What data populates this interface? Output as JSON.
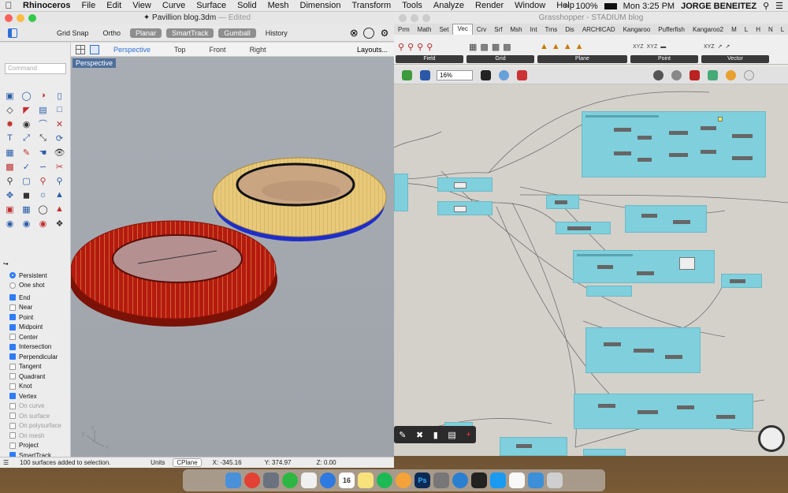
{
  "menubar": {
    "app": "Rhinoceros",
    "items": [
      "File",
      "Edit",
      "View",
      "Curve",
      "Surface",
      "Solid",
      "Mesh",
      "Dimension",
      "Transform",
      "Tools",
      "Analyze",
      "Render",
      "Window",
      "Help"
    ],
    "battery": "100%",
    "clock": "Mon 3:25 PM",
    "user": "JORGE BENEITEZ"
  },
  "rhino": {
    "file_name": "Pavillion blog.3dm",
    "file_state": "— Edited",
    "toolbar": {
      "grid_snap": "Grid Snap",
      "ortho": "Ortho",
      "planar": "Planar",
      "smarttrack": "SmartTrack",
      "gumball": "Gumball",
      "history": "History"
    },
    "viewport_tabs": [
      "Perspective",
      "Top",
      "Front",
      "Right"
    ],
    "layouts": "Layouts...",
    "command_placeholder": "Command",
    "viewport_label": "Perspective",
    "osnap_mode": [
      {
        "label": "Persistent",
        "selected": true
      },
      {
        "label": "One shot",
        "selected": false
      }
    ],
    "osnaps": [
      {
        "label": "End",
        "checked": true,
        "enabled": true
      },
      {
        "label": "Near",
        "checked": false,
        "enabled": true
      },
      {
        "label": "Point",
        "checked": true,
        "enabled": true
      },
      {
        "label": "Midpoint",
        "checked": true,
        "enabled": true
      },
      {
        "label": "Center",
        "checked": false,
        "enabled": true
      },
      {
        "label": "Intersection",
        "checked": true,
        "enabled": true
      },
      {
        "label": "Perpendicular",
        "checked": true,
        "enabled": true
      },
      {
        "label": "Tangent",
        "checked": false,
        "enabled": true
      },
      {
        "label": "Quadrant",
        "checked": false,
        "enabled": true
      },
      {
        "label": "Knot",
        "checked": false,
        "enabled": true
      },
      {
        "label": "Vertex",
        "checked": true,
        "enabled": true
      },
      {
        "label": "On curve",
        "checked": false,
        "enabled": false
      },
      {
        "label": "On surface",
        "checked": false,
        "enabled": false
      },
      {
        "label": "On polysurface",
        "checked": false,
        "enabled": false
      },
      {
        "label": "On mesh",
        "checked": false,
        "enabled": false
      },
      {
        "label": "Project",
        "checked": false,
        "enabled": true
      },
      {
        "label": "SmartTrack",
        "checked": true,
        "enabled": true
      }
    ],
    "status": {
      "message": "100 surfaces added to selection.",
      "units": "Units",
      "cplane": "CPlane",
      "x": "X: -345.16",
      "y": "Y: 374.97",
      "z": "Z: 0.00"
    },
    "axis_labels": {
      "x": "x",
      "y": "y",
      "z": "z"
    },
    "colors": {
      "red_stadium": "#b51a0f",
      "yellow_stadium": "#e8c97a",
      "blue_edge": "#2233cc"
    }
  },
  "grasshopper": {
    "title": "Grasshopper - STADIUM blog",
    "tabs": [
      "Prm",
      "Math",
      "Set",
      "Vec",
      "Crv",
      "Srf",
      "Msh",
      "Int",
      "Trns",
      "Dis",
      "ARCHICAD",
      "Kangaroo",
      "Pufferfish",
      "Kangaroo2",
      "M",
      "L",
      "H",
      "N",
      "L"
    ],
    "active_tab": "Vec",
    "ribbon_groups": [
      "Field",
      "Grid",
      "Plane",
      "Point",
      "Vector"
    ],
    "zoom": "16%",
    "cluster_color": "#7fcfdc"
  },
  "dock": {
    "calendar_day": "16",
    "apps": [
      "finder",
      "chrome",
      "launchpad",
      "whatsapp",
      "notes",
      "things",
      "calendar",
      "stickies",
      "spotify",
      "photos",
      "photoshop",
      "rhino",
      "edge",
      "activity-monitor",
      "appstore",
      "files",
      "maps",
      "trash"
    ]
  }
}
